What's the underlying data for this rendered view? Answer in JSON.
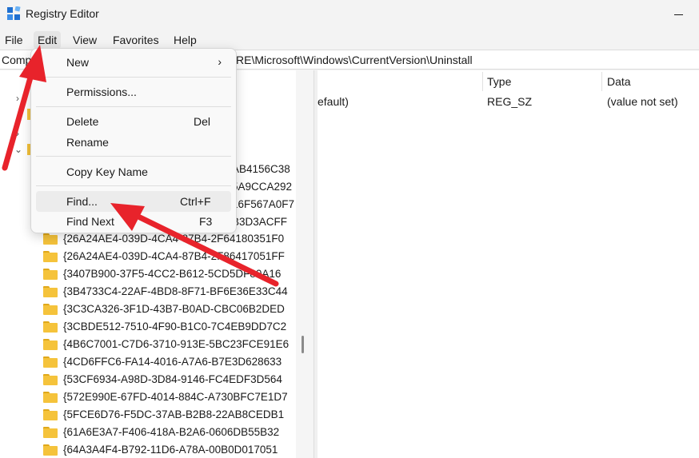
{
  "window": {
    "title": "Registry Editor"
  },
  "menubar": {
    "items": [
      "File",
      "Edit",
      "View",
      "Favorites",
      "Help"
    ],
    "active": "Edit"
  },
  "address": {
    "left_text": "Comp",
    "right_text": "RE\\Microsoft\\Windows\\CurrentVersion\\Uninstall"
  },
  "tree": {
    "visible_right_fragments": [
      "AB4156C38",
      "5A9CCA292",
      "16F567A0F7",
      "B3D3ACFF"
    ],
    "items": [
      "{26A24AE4-039D-4CA4-87B4-2F64180351F0",
      "{26A24AE4-039D-4CA4-87B4-2F86417051FF",
      "{3407B900-37F5-4CC2-B612-5CD5DF80A16",
      "{3B4733C4-22AF-4BD8-8F71-BF6E36E33C44",
      "{3C3CA326-3F1D-43B7-B0AD-CBC06B2DED",
      "{3CBDE512-7510-4F90-B1C0-7C4EB9DD7C2",
      "{4B6C7001-C7D6-3710-913E-5BC23FCE91E6",
      "{4CD6FFC6-FA14-4016-A7A6-B7E3D628633",
      "{53CF6934-A98D-3D84-9146-FC4EDF3D564",
      "{572E990E-67FD-4014-884C-A730BFC7E1D7",
      "{5FCE6D76-F5DC-37AB-B2B8-22AB8CEDB1",
      "{61A6E3A7-F406-418A-B2A6-0606DB55B32",
      "{64A3A4F4-B792-11D6-A78A-00B0D017051"
    ]
  },
  "values": {
    "headers": {
      "name": "",
      "type": "Type",
      "data": "Data"
    },
    "rows": [
      {
        "name": "efault)",
        "type": "REG_SZ",
        "data": "(value not set)"
      }
    ]
  },
  "context_menu": {
    "items": [
      {
        "label": "New",
        "shortcut": "",
        "submenu": true
      },
      {
        "label": "Permissions...",
        "shortcut": ""
      },
      {
        "label": "Delete",
        "shortcut": "Del"
      },
      {
        "label": "Rename",
        "shortcut": ""
      },
      {
        "label": "Copy Key Name",
        "shortcut": ""
      },
      {
        "label": "Find...",
        "shortcut": "Ctrl+F",
        "highlighted": true
      },
      {
        "label": "Find Next",
        "shortcut": "F3"
      }
    ]
  },
  "icons": {
    "app": "registry-editor-icon",
    "folder": "folder-icon",
    "submenu": "chevron-right-icon",
    "collapsed": "chevron-right-icon",
    "expanded": "chevron-down-icon",
    "minimize": "minimize-icon"
  },
  "colors": {
    "annotation_arrow": "#e8232b",
    "folder": "#f5c33b",
    "menu_highlight": "#ececec"
  }
}
